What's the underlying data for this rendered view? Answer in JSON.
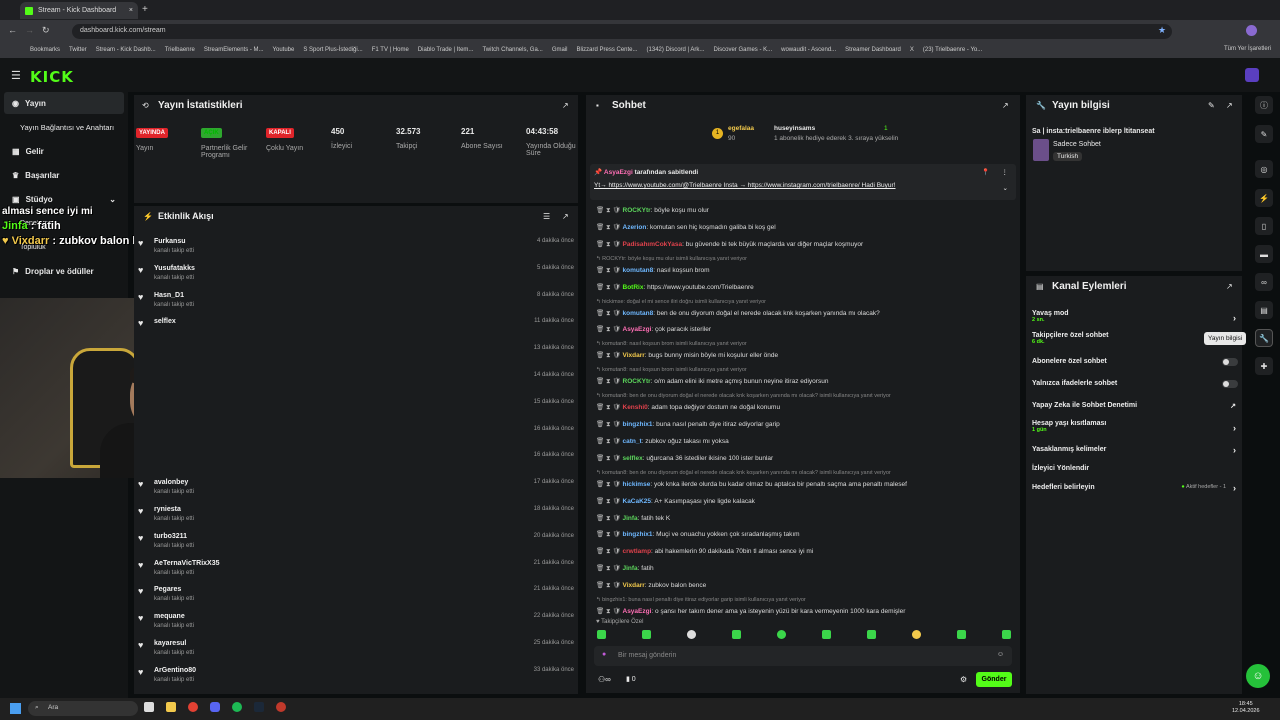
{
  "browser": {
    "tab_title": "Stream - Kick Dashboard",
    "url": "dashboard.kick.com/stream",
    "bookmarks": [
      "Bookmarks",
      "Twitter",
      "Stream - Kick Dashb...",
      "Trielbaenre",
      "StreamElements - M...",
      "Youtube",
      "S Sport Plus-İstediği...",
      "F1 TV | Home",
      "Diablo Trade | Item...",
      "Twitch Channels, Ga...",
      "Gmail",
      "Blizzard Press Cente...",
      "(1342) Discord | Ark...",
      "Discover Games - K...",
      "wowaudit - Ascend...",
      "Streamer Dashboard",
      "X",
      "(23) Trielbaenre - Yo..."
    ],
    "all_bookmarks": "Tüm Yer İşaretleri"
  },
  "brand": {
    "logo": "KICK"
  },
  "sidebar": {
    "items": [
      {
        "label": "Yayın"
      },
      {
        "label": "Yayın Bağlantısı ve Anahtarı"
      },
      {
        "label": "Gelir"
      },
      {
        "label": "Başarılar"
      },
      {
        "label": "Stüdyo"
      },
      {
        "label": "Deneteme"
      },
      {
        "label": "Topluluk"
      },
      {
        "label": "Droplar ve ödüller"
      }
    ]
  },
  "overlay": {
    "lines": [
      {
        "user": "",
        "text": "almasi sence iyi mi"
      },
      {
        "user": "Jinfa",
        "text": "fatih"
      },
      {
        "user": "Vixdarr",
        "text": "zubkov balon bence"
      }
    ]
  },
  "stats": {
    "title": "Yayın İstatistikleri",
    "items": [
      {
        "value": "YAYINDA",
        "label": "Yayın",
        "color": "#e0242a"
      },
      {
        "value": "AÇIK",
        "label": "Partnerlik Gelir Programı",
        "color": "#2ea82e"
      },
      {
        "value": "KAPALI",
        "label": "Çoklu Yayın",
        "color": "#e0242a"
      },
      {
        "value": "450",
        "label": "İzleyici"
      },
      {
        "value": "32.573",
        "label": "Takipçi"
      },
      {
        "value": "221",
        "label": "Abone Sayısı"
      },
      {
        "value": "04:43:58",
        "label": "Yayında Olduğu Süre"
      }
    ]
  },
  "events": {
    "title": "Etkinlik Akışı",
    "items": [
      {
        "name": "Furkansu",
        "sub": "kanalı takip etti",
        "time": "4 dakika önce"
      },
      {
        "name": "Yusufatakks",
        "sub": "kanalı takip etti",
        "time": "5 dakika önce"
      },
      {
        "name": "Hasn_D1",
        "sub": "kanalı takip etti",
        "time": "8 dakika önce"
      },
      {
        "name": "selflex",
        "sub": "",
        "time": "11 dakika önce"
      },
      {
        "name": "",
        "sub": "",
        "time": "13 dakika önce"
      },
      {
        "name": "",
        "sub": "",
        "time": "14 dakika önce"
      },
      {
        "name": "",
        "sub": "",
        "time": "15 dakika önce"
      },
      {
        "name": "",
        "sub": "",
        "time": "16 dakika önce"
      },
      {
        "name": "",
        "sub": "",
        "time": "16 dakika önce"
      },
      {
        "name": "avalonbey",
        "sub": "kanalı takip etti",
        "time": "17 dakika önce"
      },
      {
        "name": "ryniesta",
        "sub": "kanalı takip etti",
        "time": "18 dakika önce"
      },
      {
        "name": "turbo3211",
        "sub": "kanalı takip etti",
        "time": "20 dakika önce"
      },
      {
        "name": "AeTernaVicTRixX35",
        "sub": "kanalı takip etti",
        "time": "21 dakika önce"
      },
      {
        "name": "Pegares",
        "sub": "kanalı takip etti",
        "time": "21 dakika önce"
      },
      {
        "name": "mequane",
        "sub": "kanalı takip etti",
        "time": "22 dakika önce"
      },
      {
        "name": "kayaresul",
        "sub": "kanalı takip etti",
        "time": "25 dakika önce"
      },
      {
        "name": "ArGentino80",
        "sub": "kanalı takip etti",
        "time": "33 dakika önce"
      }
    ]
  },
  "chat": {
    "title": "Sohbet",
    "gift": {
      "user1": "egefalaa",
      "count1": "90",
      "user2": "huseyinsams",
      "count2": "1",
      "text": "1 abonelik hediye ederek 3. sıraya yükselin"
    },
    "pinned": {
      "by": "AsyaEzgi",
      "by_suffix": "tarafından sabitlendi",
      "text": "Yt→ https://www.youtube.com/@Trielbaenre Insta → https://www.instagram.com/trielbaenre/ Hadi Buyur!"
    },
    "messages": [
      {
        "reply": "",
        "user": "ROCKYtr",
        "color": "#5cd65c",
        "text": "böyle koşu mu olur"
      },
      {
        "reply": "",
        "user": "Azerion",
        "color": "#6fb8ff",
        "text": "komutan sen hiç koşmadın galiba bi koş gel"
      },
      {
        "reply": "",
        "user": "PadisahımCokYasa",
        "color": "#e0424c",
        "text": "bu güvende bi tek büyük maçlarda var diğer maçlar koşmuyor"
      },
      {
        "reply": "ROCKYtr: böyle koşu mu olur isimli kullanıcıya yanıt veriyor",
        "user": "komutan8",
        "color": "#6fb8ff",
        "text": "nasıl koşsun brom"
      },
      {
        "reply": "",
        "user": "BotRix",
        "color": "#53fc18",
        "text": "https://www.youtube.com/Trielbaenre"
      },
      {
        "reply": "hickimse: doğal el mi sence iliri doğru isimli kullanıcıya yanıt veriyor",
        "user": "komutan8",
        "color": "#6fb8ff",
        "text": "ben de onu diyorum doğal el nerede olacak knk koşarken yanında mı olacak?"
      },
      {
        "reply": "",
        "user": "AsyaEzgi",
        "color": "#ff6fb5",
        "text": "çok paracık isteriler"
      },
      {
        "reply": "komutan8: nasıl koşsun brom isimli kullanıcıya yanıt veriyor",
        "user": "Vixdarr",
        "color": "#f2c94c",
        "text": "bugs bunny misin böyle mi koşulur eller önde"
      },
      {
        "reply": "komutan8: nasıl koşsun brom isimli kullanıcıya yanıt veriyor",
        "user": "ROCKYtr",
        "color": "#5cd65c",
        "text": "o/m adam elini iki metre açmış bunun neyine itiraz ediyorsun"
      },
      {
        "reply": "komutan8: ben de onu diyorum doğal el nerede olacak knk koşarken yanında mı olacak? isimli kullanıcıya yanıt veriyor",
        "user": "Kenshi0",
        "color": "#e0424c",
        "text": "adam topa değiyor dostum ne doğal konumu"
      },
      {
        "reply": "",
        "user": "bingzhix1",
        "color": "#6fb8ff",
        "text": "buna nasıl penaltı diye itiraz ediyorlar garip"
      },
      {
        "reply": "",
        "user": "catn_t",
        "color": "#6fb8ff",
        "text": "zubkov oğuz takası mı yoksa"
      },
      {
        "reply": "",
        "user": "selflex",
        "color": "#5cd65c",
        "text": "uğurcana 36 istediler ikisine 100 ister bunlar"
      },
      {
        "reply": "komutan8: ben de onu diyorum doğal el nerede olacak knk koşarken yanında mı olacak? isimli kullanıcıya yanıt veriyor",
        "user": "hickimse",
        "color": "#6fb8ff",
        "text": "yok knka ilerde olurda bu kadar olmaz bu aptalca bir penaltı saçma ama penaltı malesef"
      },
      {
        "reply": "",
        "user": "KaCaK25",
        "color": "#6fb8ff",
        "text": "A+ Kasımpaşası yine ligde kalacak"
      },
      {
        "reply": "",
        "user": "Jinfa",
        "color": "#5cd65c",
        "text": "fatih tek K"
      },
      {
        "reply": "",
        "user": "bingzhix1",
        "color": "#6fb8ff",
        "text": "Muçi ve onuachu yokken çok sıradanlaşmış takım"
      },
      {
        "reply": "",
        "user": "crwtlamp",
        "color": "#e0424c",
        "text": "abi hakemlerin 90 dakikada 70bin tl alması sence iyi mi"
      },
      {
        "reply": "",
        "user": "Jinfa",
        "color": "#5cd65c",
        "text": "fatih"
      },
      {
        "reply": "",
        "user": "Vixdarr",
        "color": "#f2c94c",
        "text": "zubkov balon bence"
      },
      {
        "reply": "bingzhix1: buna nasıl penaltı diye itiraz ediyorlar garip isimli kullanıcıya yanıt veriyor",
        "user": "AsyaEzgi",
        "color": "#ff6fb5",
        "text": "o şansı her takım dener ama ya isteyenin yüzü bir kara vermeyenin 1000 kara demişler"
      }
    ],
    "followers_only": "Takipçilere Özel",
    "placeholder": "Bir mesaj gönderin",
    "send": "Gönder",
    "count": "0"
  },
  "stream_info": {
    "title": "Yayın bilgisi",
    "stream_title": "Sa | insta:trielbaenre iblerp ltitanseat",
    "category": "Sadece Sohbet",
    "language": "Turkish",
    "tooltip": "Yayın bilgisi"
  },
  "actions": {
    "title": "Kanal Eylemleri",
    "items": [
      {
        "label": "Yavaş mod",
        "sub": "2 sn."
      },
      {
        "label": "Takipçilere özel sohbet",
        "sub": "6 dk."
      },
      {
        "label": "Abonelere özel sohbet",
        "sub": ""
      },
      {
        "label": "Yalnızca ifadelerle sohbet",
        "sub": ""
      },
      {
        "label": "Yapay Zeka ile Sohbet Denetimi",
        "sub": ""
      },
      {
        "label": "Hesap yaşı kısıtlaması",
        "sub": "1 gün"
      },
      {
        "label": "Yasaklanmış kelimeler",
        "sub": ""
      },
      {
        "label": "İzleyici Yönlendir",
        "sub": ""
      },
      {
        "label": "Hedefleri belirleyin",
        "sub": ""
      }
    ],
    "active_goals": "Aktif hedefler - 1"
  },
  "taskbar": {
    "search": "Ara",
    "time": "18:45",
    "date": "12.04.2026"
  }
}
